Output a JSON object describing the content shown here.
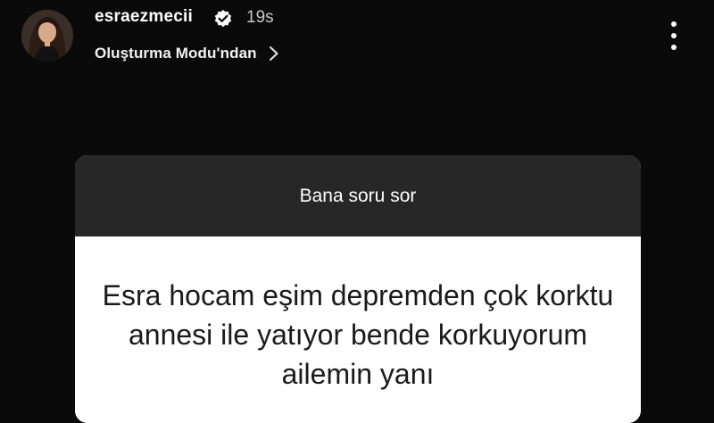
{
  "header": {
    "username": "esraezmecii",
    "time": "19s",
    "source_label": "Oluşturma Modu'ndan",
    "verified": true,
    "icons": {
      "avatar": "profile-photo",
      "verified": "verified-badge-icon",
      "chevron": "chevron-right-icon",
      "more": "more-vertical-icon"
    }
  },
  "question_card": {
    "title": "Bana soru sor",
    "question": "Esra hocam eşim depremden çok korktu annesi ile yatıyor bende korkuyorum ailemin yanı"
  },
  "colors": {
    "background": "#0a0a0a",
    "card_header": "#272727",
    "card_body": "#ffffff",
    "question_text": "#1a1a1a"
  }
}
